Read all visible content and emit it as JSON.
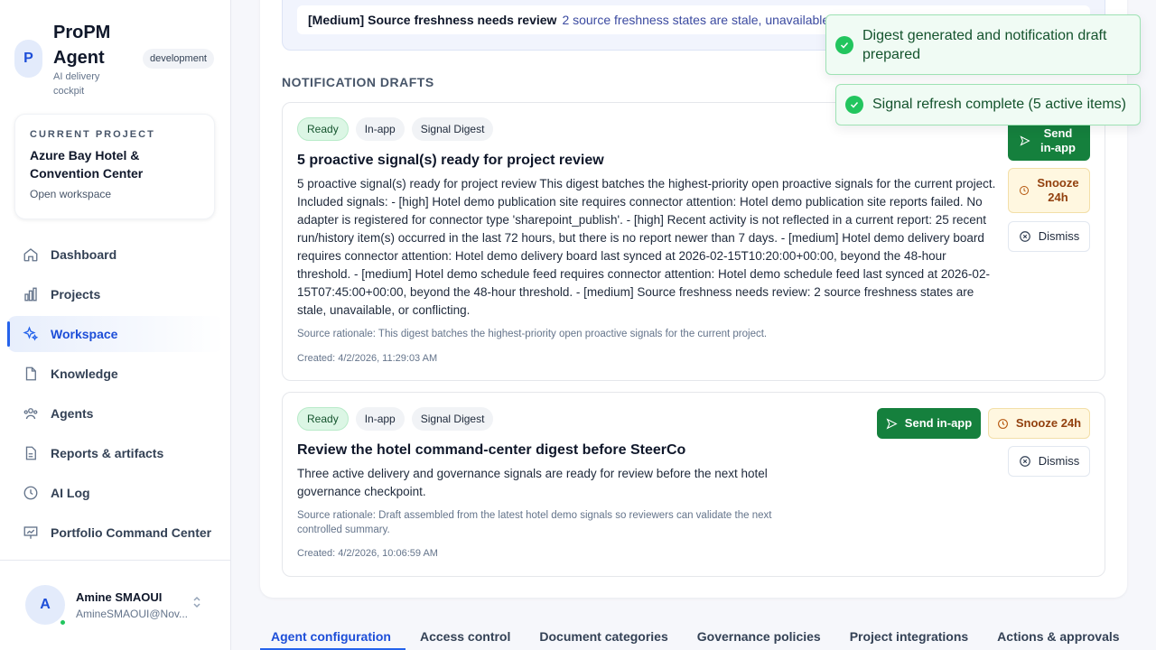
{
  "brand": {
    "logo_letter": "P",
    "name": "ProPM Agent",
    "subtitle": "AI delivery cockpit",
    "env": "development"
  },
  "project": {
    "eyebrow": "CURRENT PROJECT",
    "name": "Azure Bay Hotel & Convention Center",
    "link": "Open workspace"
  },
  "nav": {
    "items": [
      {
        "label": "Dashboard",
        "icon": "home-icon"
      },
      {
        "label": "Projects",
        "icon": "bar-chart-icon"
      },
      {
        "label": "Workspace",
        "icon": "sparkles-icon",
        "active": true
      },
      {
        "label": "Knowledge",
        "icon": "document-icon"
      },
      {
        "label": "Agents",
        "icon": "users-icon"
      },
      {
        "label": "Reports & artifacts",
        "icon": "report-icon"
      },
      {
        "label": "AI Log",
        "icon": "clock-icon"
      },
      {
        "label": "Portfolio Command Center",
        "icon": "presentation-icon"
      }
    ]
  },
  "user": {
    "initial": "A",
    "name": "Amine SMAOUI",
    "email": "AmineSMAOUI@Nov..."
  },
  "signal": {
    "severity": "[Medium] Source freshness needs review",
    "description": "2 source freshness states are stale, unavailable, or"
  },
  "section_title": "NOTIFICATION DRAFTS",
  "drafts": [
    {
      "badges": [
        "Ready",
        "In-app",
        "Signal Digest"
      ],
      "title": "5 proactive signal(s) ready for project review",
      "body": "5 proactive signal(s) ready for project review This digest batches the highest-priority open proactive signals for the current project. Included signals: - [high] Hotel demo publication site requires connector attention: Hotel demo publication site reports failed. No adapter is registered for connector type 'sharepoint_publish'. - [high] Recent activity is not reflected in a current report: 25 recent run/history item(s) occurred in the last 72 hours, but there is no report newer than 7 days. - [medium] Hotel demo delivery board requires connector attention: Hotel demo delivery board last synced at 2026-02-15T10:20:00+00:00, beyond the 48-hour threshold. - [medium] Hotel demo schedule feed requires connector attention: Hotel demo schedule feed last synced at 2026-02-15T07:45:00+00:00, beyond the 48-hour threshold. - [medium] Source freshness needs review: 2 source freshness states are stale, unavailable, or conflicting.",
      "rationale": "Source rationale: This digest batches the highest-priority open proactive signals for the current project.",
      "created": "Created: 4/2/2026, 11:29:03 AM",
      "send_label": "Send in-app",
      "snooze_label": "Snooze 24h",
      "dismiss_label": "Dismiss"
    },
    {
      "badges": [
        "Ready",
        "In-app",
        "Signal Digest"
      ],
      "title": "Review the hotel command-center digest before SteerCo",
      "body": "Three active delivery and governance signals are ready for review before the next hotel governance checkpoint.",
      "rationale": "Source rationale: Draft assembled from the latest hotel demo signals so reviewers can validate the next controlled summary.",
      "created": "Created: 4/2/2026, 10:06:59 AM",
      "send_label": "Send in-app",
      "snooze_label": "Snooze 24h",
      "dismiss_label": "Dismiss"
    }
  ],
  "tabs": [
    "Agent configuration",
    "Access control",
    "Document categories",
    "Governance policies",
    "Project integrations",
    "Actions & approvals"
  ],
  "toasts": [
    {
      "message": "Digest generated and notification draft prepared"
    },
    {
      "message": "Signal refresh complete (5 active items)"
    }
  ],
  "colors": {
    "accent": "#2563eb",
    "success": "#15803d",
    "warning_bg": "#fff7e0"
  }
}
